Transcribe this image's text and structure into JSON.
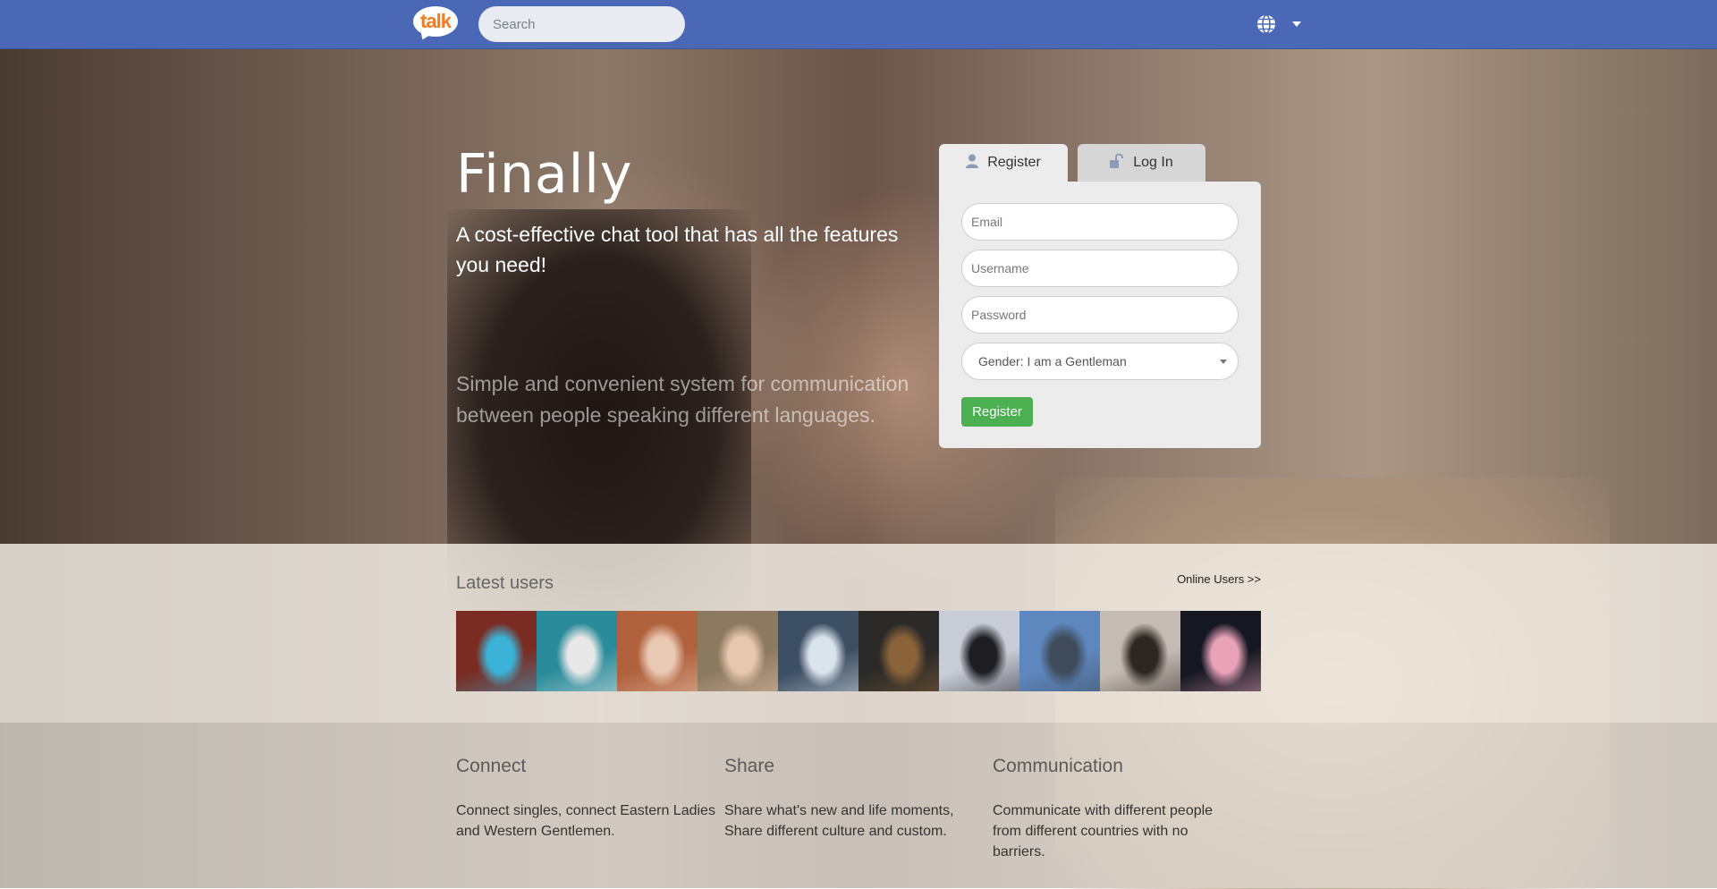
{
  "header": {
    "logo_text": "talk",
    "search_placeholder": "Search",
    "language_icon": "globe-icon",
    "colors": {
      "bar": "#4a68b5",
      "logo_accent": "#f47b20"
    }
  },
  "hero": {
    "title": "Finally",
    "subtitle": "A cost-effective chat tool that has all the features you need!",
    "description": "Simple and convenient system for communication between people speaking different languages."
  },
  "auth": {
    "tabs": [
      {
        "label": "Register",
        "icon": "user-icon",
        "active": true
      },
      {
        "label": "Log In",
        "icon": "unlock-icon",
        "active": false
      }
    ],
    "email_placeholder": "Email",
    "username_placeholder": "Username",
    "password_placeholder": "Password",
    "gender_selected": "Gender: I am a Gentleman",
    "submit_label": "Register",
    "colors": {
      "submit": "#4caf50"
    }
  },
  "latest": {
    "title": "Latest users",
    "online_link": "Online Users >>",
    "avatars": [
      {
        "palette": [
          "#7a2c22",
          "#3bb3d8"
        ]
      },
      {
        "palette": [
          "#2a8c9a",
          "#e8e8e8"
        ]
      },
      {
        "palette": [
          "#b0623d",
          "#e9c9b4"
        ]
      },
      {
        "palette": [
          "#8c7a60",
          "#e8c7b0"
        ]
      },
      {
        "palette": [
          "#3d4f63",
          "#dbe4ec"
        ]
      },
      {
        "palette": [
          "#2b2a28",
          "#8a6438"
        ]
      },
      {
        "palette": [
          "#c7ccd6",
          "#1e1e22"
        ]
      },
      {
        "palette": [
          "#5d87bd",
          "#3f4b5a"
        ]
      },
      {
        "palette": [
          "#c4bcb2",
          "#2d2622"
        ]
      },
      {
        "palette": [
          "#151822",
          "#e9a2b8"
        ]
      }
    ]
  },
  "features": [
    {
      "title": "Connect",
      "text": "Connect singles, connect Eastern Ladies and Western Gentlemen."
    },
    {
      "title": "Share",
      "text": "Share what's new and life moments, Share different culture and custom."
    },
    {
      "title": "Communication",
      "text": "Communicate with different people from different countries with no barriers."
    }
  ]
}
